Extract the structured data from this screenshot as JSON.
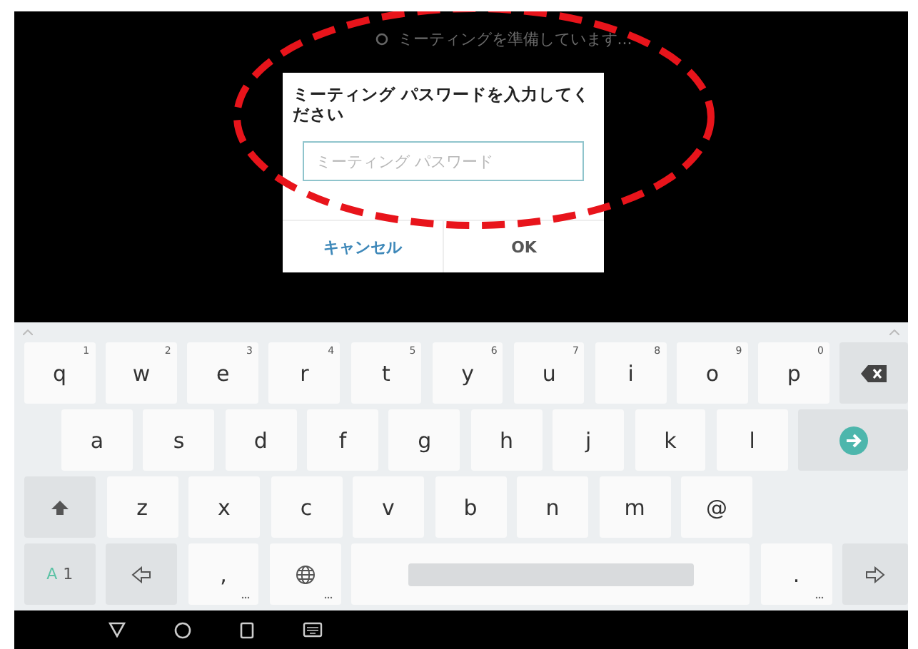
{
  "status": {
    "text": "ミーティングを準備しています..."
  },
  "dialog": {
    "title": "ミーティング パスワードを入力してください",
    "field": {
      "placeholder": "ミーティング パスワード"
    },
    "buttons": [
      {
        "label": "キャンセル",
        "kind": "cancel"
      },
      {
        "label": "OK",
        "kind": "ok"
      }
    ]
  },
  "keyboard": {
    "rows": [
      {
        "keys": [
          {
            "kind": "char",
            "label": "q",
            "hint": "1"
          },
          {
            "kind": "char",
            "label": "w",
            "hint": "2"
          },
          {
            "kind": "char",
            "label": "e",
            "hint": "3"
          },
          {
            "kind": "char",
            "label": "r",
            "hint": "4"
          },
          {
            "kind": "char",
            "label": "t",
            "hint": "5"
          },
          {
            "kind": "char",
            "label": "y",
            "hint": "6"
          },
          {
            "kind": "char",
            "label": "u",
            "hint": "7"
          },
          {
            "kind": "char",
            "label": "i",
            "hint": "8"
          },
          {
            "kind": "char",
            "label": "o",
            "hint": "9"
          },
          {
            "kind": "char",
            "label": "p",
            "hint": "0"
          },
          {
            "kind": "backspace"
          }
        ]
      },
      {
        "keys": [
          {
            "kind": "char",
            "label": "a"
          },
          {
            "kind": "char",
            "label": "s"
          },
          {
            "kind": "char",
            "label": "d"
          },
          {
            "kind": "char",
            "label": "f"
          },
          {
            "kind": "char",
            "label": "g"
          },
          {
            "kind": "char",
            "label": "h"
          },
          {
            "kind": "char",
            "label": "j"
          },
          {
            "kind": "char",
            "label": "k"
          },
          {
            "kind": "char",
            "label": "l"
          },
          {
            "kind": "enter"
          }
        ]
      },
      {
        "keys": [
          {
            "kind": "shift"
          },
          {
            "kind": "char",
            "label": "z"
          },
          {
            "kind": "char",
            "label": "x"
          },
          {
            "kind": "char",
            "label": "c"
          },
          {
            "kind": "char",
            "label": "v"
          },
          {
            "kind": "char",
            "label": "b"
          },
          {
            "kind": "char",
            "label": "n"
          },
          {
            "kind": "char",
            "label": "m"
          },
          {
            "kind": "char",
            "label": "@"
          }
        ]
      },
      {
        "keys": [
          {
            "kind": "mode",
            "label": "A",
            "label2": "1"
          },
          {
            "kind": "left"
          },
          {
            "kind": "char",
            "label": ",",
            "more": true
          },
          {
            "kind": "globe"
          },
          {
            "kind": "space"
          },
          {
            "kind": "char",
            "label": ".",
            "more": true
          },
          {
            "kind": "right"
          }
        ]
      }
    ]
  }
}
